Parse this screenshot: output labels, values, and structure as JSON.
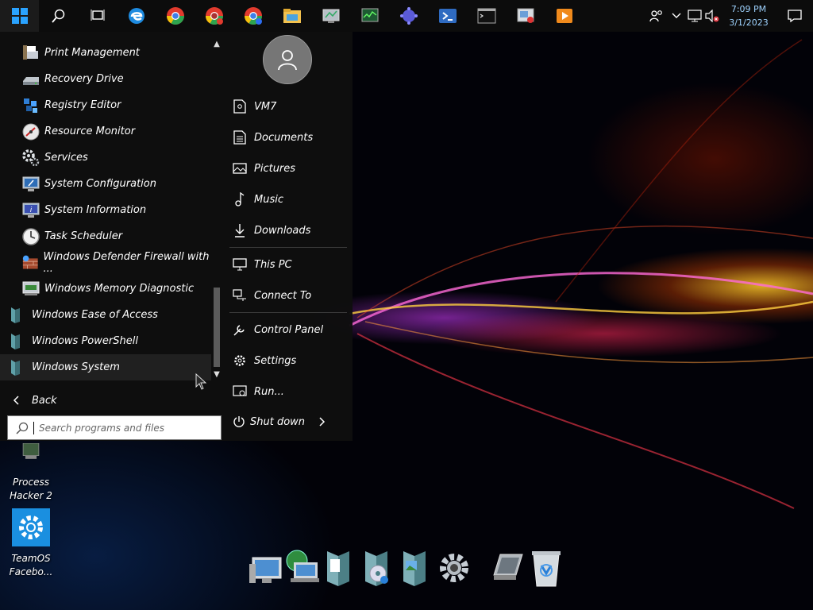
{
  "taskbar": {
    "start": "start-icon",
    "pinned": [
      "search-icon",
      "task-view-icon",
      "edge-icon",
      "chrome-icon",
      "chrome-icon",
      "chrome-icon",
      "file-explorer-icon",
      "network-monitor-icon",
      "task-manager-icon",
      "network-globe-icon",
      "powershell-icon",
      "command-prompt-icon",
      "remote-desktop-icon",
      "media-player-icon"
    ],
    "tray": {
      "time": "7:09 PM",
      "date": "3/1/2023"
    }
  },
  "start_menu": {
    "programs": [
      {
        "label": "Print Management",
        "icon": "print-management-icon"
      },
      {
        "label": "Recovery Drive",
        "icon": "recovery-drive-icon"
      },
      {
        "label": "Registry Editor",
        "icon": "registry-editor-icon"
      },
      {
        "label": "Resource Monitor",
        "icon": "resource-monitor-icon"
      },
      {
        "label": "Services",
        "icon": "services-icon"
      },
      {
        "label": "System Configuration",
        "icon": "system-configuration-icon"
      },
      {
        "label": "System Information",
        "icon": "system-information-icon"
      },
      {
        "label": "Task Scheduler",
        "icon": "task-scheduler-icon"
      },
      {
        "label": "Windows Defender Firewall with ...",
        "icon": "firewall-icon"
      },
      {
        "label": "Windows Memory Diagnostic",
        "icon": "memory-diagnostic-icon"
      },
      {
        "label": "Windows Ease of Access",
        "icon": "folder-icon"
      },
      {
        "label": "Windows PowerShell",
        "icon": "folder-icon"
      },
      {
        "label": "Windows System",
        "icon": "folder-icon"
      }
    ],
    "back_label": "Back",
    "search_placeholder": "Search programs and files",
    "places": {
      "user": "VM7",
      "documents": "Documents",
      "pictures": "Pictures",
      "music": "Music",
      "downloads": "Downloads",
      "this_pc": "This PC",
      "connect_to": "Connect To",
      "control_panel": "Control Panel",
      "settings": "Settings",
      "run": "Run..."
    },
    "shutdown_label": "Shut down"
  },
  "desktop": {
    "icons": [
      {
        "label": "Process Hacker 2"
      },
      {
        "label": "TeamOS Facebo..."
      }
    ]
  },
  "dock": [
    "computer-icon",
    "network-icon",
    "documents-folder-icon",
    "media-folder-icon",
    "pictures-folder-icon",
    "settings-gear-icon",
    "system-info-icon",
    "recycle-bin-icon"
  ]
}
